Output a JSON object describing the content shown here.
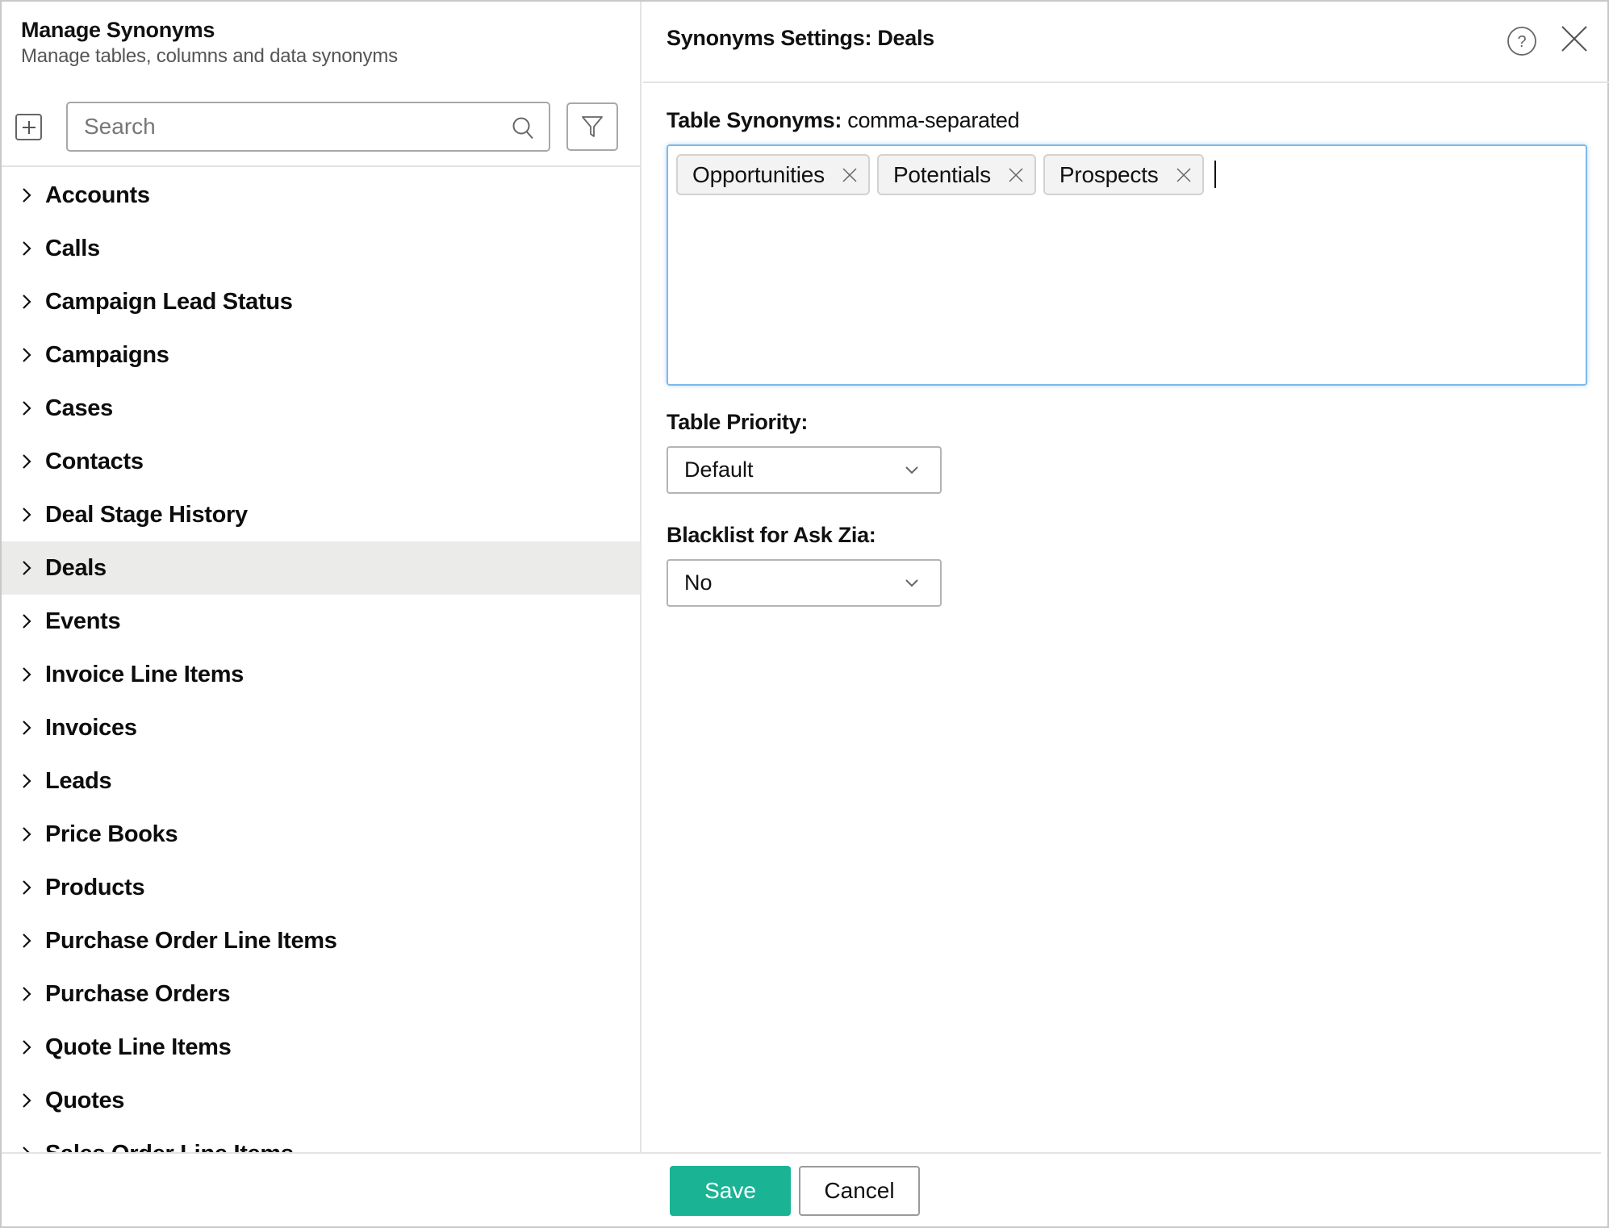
{
  "left_panel": {
    "title": "Manage Synonyms",
    "subtitle": "Manage tables, columns and data synonyms",
    "add_icon": "plus-square-icon",
    "search": {
      "placeholder": "Search",
      "value": ""
    },
    "filter_icon": "funnel-icon",
    "selected_item": "Deals",
    "items": [
      {
        "label": "Accounts"
      },
      {
        "label": "Calls"
      },
      {
        "label": "Campaign Lead Status"
      },
      {
        "label": "Campaigns"
      },
      {
        "label": "Cases"
      },
      {
        "label": "Contacts"
      },
      {
        "label": "Deal Stage History"
      },
      {
        "label": "Deals"
      },
      {
        "label": "Events"
      },
      {
        "label": "Invoice Line Items"
      },
      {
        "label": "Invoices"
      },
      {
        "label": "Leads"
      },
      {
        "label": "Price Books"
      },
      {
        "label": "Products"
      },
      {
        "label": "Purchase Order Line Items"
      },
      {
        "label": "Purchase Orders"
      },
      {
        "label": "Quote Line Items"
      },
      {
        "label": "Quotes"
      },
      {
        "label": "Sales Order Line Items"
      }
    ]
  },
  "right_panel": {
    "title": "Synonyms Settings: Deals",
    "help_icon": "question-circle-icon",
    "close_icon": "close-x-icon",
    "table_synonyms": {
      "label": "Table Synonyms:",
      "hint": " comma-separated",
      "chips": [
        "Opportunities",
        "Potentials",
        "Prospects"
      ]
    },
    "table_priority": {
      "label": "Table Priority:",
      "value": "Default"
    },
    "blacklist": {
      "label": "Blacklist for Ask Zia:",
      "value": "No"
    }
  },
  "footer": {
    "save_label": "Save",
    "cancel_label": "Cancel"
  },
  "colors": {
    "primary": "#1ab394",
    "focus_border": "#7fb9ea",
    "selected_row": "#ebebea"
  }
}
